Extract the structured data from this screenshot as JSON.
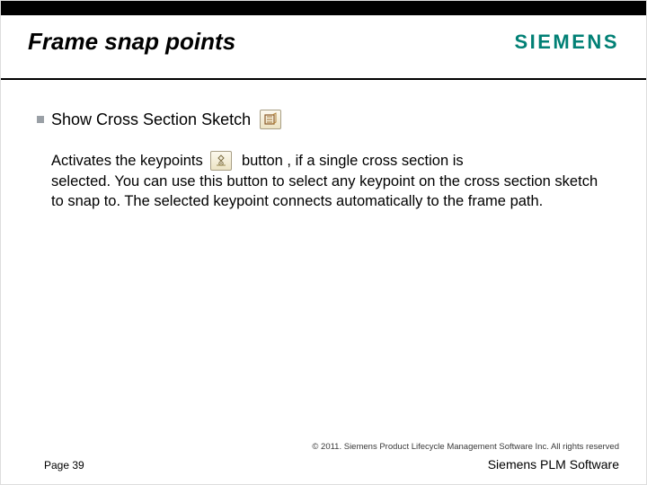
{
  "header": {
    "title": "Frame snap points",
    "brand": "SIEMENS"
  },
  "bullet": {
    "label": "Show Cross Section Sketch",
    "icon_name": "cross-section-sketch-icon"
  },
  "body": {
    "pre_icon": "Activates the keypoints",
    "post_icon": "button , if a single cross section is",
    "rest": "selected. You can use this button to select any keypoint on the cross section sketch to snap to. The selected keypoint connects automatically to the frame path.",
    "inline_icon_name": "keypoints-icon"
  },
  "footer": {
    "copyright": "© 2011. Siemens Product Lifecycle Management Software Inc. All rights reserved",
    "page": "Page 39",
    "product": "Siemens PLM Software"
  }
}
